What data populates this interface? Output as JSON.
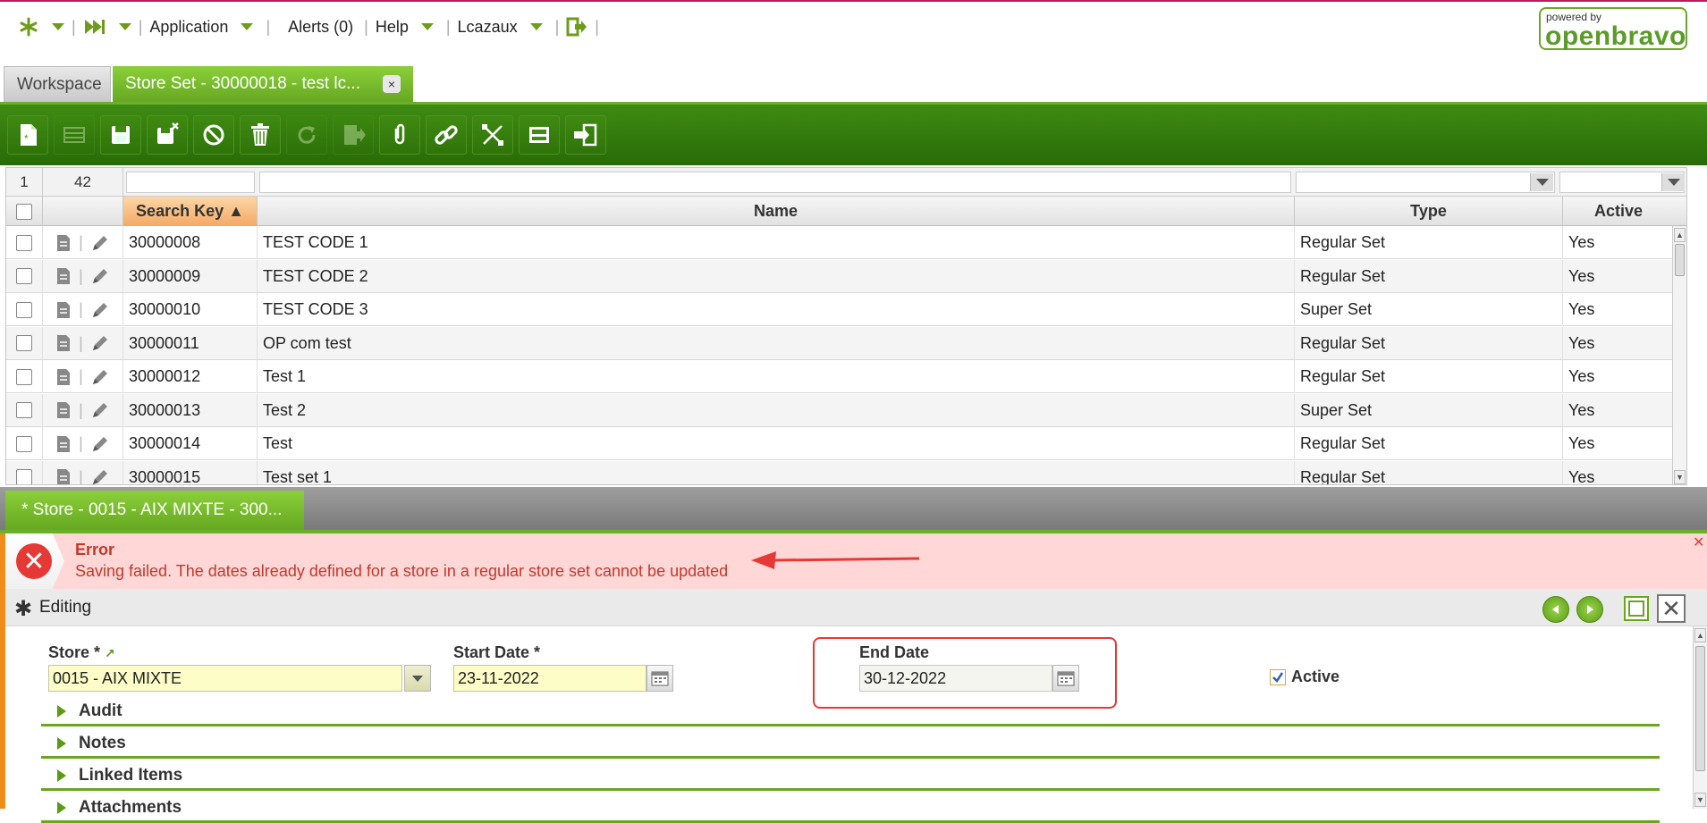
{
  "nav": {
    "application": "Application",
    "alerts": "Alerts (0)",
    "help": "Help",
    "user": "Lcazaux",
    "logo_small": "powered by",
    "logo_big": "openbravo"
  },
  "tabs": {
    "workspace": "Workspace",
    "active": "Store Set - 30000018 - test lc...",
    "close": "×"
  },
  "grid": {
    "count_left": "1",
    "count_right": "42",
    "columns": {
      "search_key": "Search Key ▲",
      "name": "Name",
      "type": "Type",
      "active": "Active"
    },
    "rows": [
      {
        "key": "30000008",
        "name": "TEST CODE 1",
        "type": "Regular Set",
        "active": "Yes"
      },
      {
        "key": "30000009",
        "name": "TEST CODE 2",
        "type": "Regular Set",
        "active": "Yes"
      },
      {
        "key": "30000010",
        "name": "TEST CODE 3",
        "type": "Super Set",
        "active": "Yes"
      },
      {
        "key": "30000011",
        "name": "OP com test",
        "type": "Regular Set",
        "active": "Yes"
      },
      {
        "key": "30000012",
        "name": "Test 1",
        "type": "Regular Set",
        "active": "Yes"
      },
      {
        "key": "30000013",
        "name": "Test 2",
        "type": "Super Set",
        "active": "Yes"
      },
      {
        "key": "30000014",
        "name": "Test",
        "type": "Regular Set",
        "active": "Yes"
      },
      {
        "key": "30000015",
        "name": "Test set 1",
        "type": "Regular Set",
        "active": "Yes"
      }
    ]
  },
  "subtab": {
    "label": "* Store - 0015 - AIX MIXTE - 300..."
  },
  "error": {
    "title": "Error",
    "message": "Saving failed. The dates already defined for a store in a regular store set cannot be updated"
  },
  "form": {
    "mode": "Editing",
    "store_label": "Store *",
    "store_value": "0015 - AIX MIXTE",
    "start_label": "Start Date *",
    "start_value": "23-11-2022",
    "end_label": "End Date",
    "end_value": "30-12-2022",
    "active_label": "Active",
    "sections": [
      "Audit",
      "Notes",
      "Linked Items",
      "Attachments"
    ]
  },
  "colors": {
    "accent_green": "#66a821",
    "toolbar_green": "#2f7309",
    "error_red": "#c0392b",
    "error_bg": "#ffd7d7",
    "required_bg": "#fdfdc8"
  }
}
